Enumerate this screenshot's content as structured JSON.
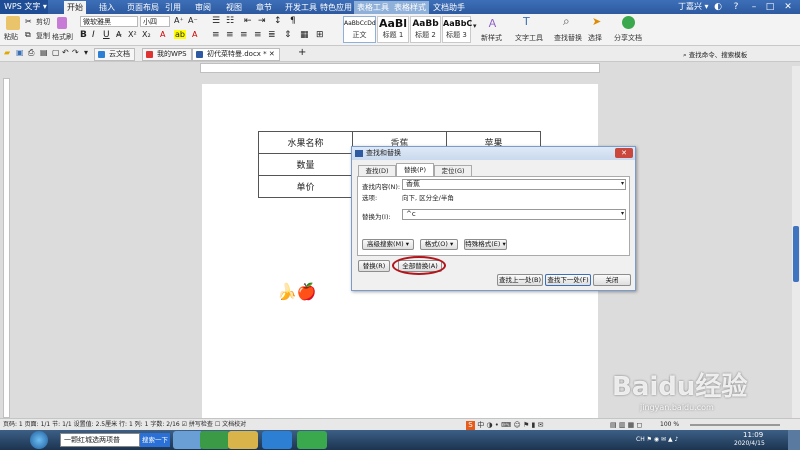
{
  "app": {
    "name": "WPS 文字",
    "user": "丁嘉兴"
  },
  "menu": {
    "tabs": [
      "开始",
      "插入",
      "页面布局",
      "引用",
      "审阅",
      "视图",
      "章节",
      "开发工具",
      "特色应用",
      "表格工具",
      "表格样式",
      "文档助手"
    ],
    "active": "开始"
  },
  "ribbon": {
    "paste": "粘贴",
    "cut": "剪切",
    "copy": "复制",
    "format_painter": "格式刷",
    "font": "微软雅黑",
    "font_size": "小四",
    "styles": [
      {
        "preview": "AaBbCcDd",
        "name": "正文"
      },
      {
        "preview": "AaBl",
        "name": "标题 1"
      },
      {
        "preview": "AaBb",
        "name": "标题 2"
      },
      {
        "preview": "AaBbC",
        "name": "标题 3"
      }
    ],
    "new_style": "新样式",
    "text_tools": "文字工具",
    "find_replace": "查找替换",
    "select": "选择",
    "share": "分享文档"
  },
  "qat": {
    "tabs": [
      "云文档",
      "我的WPS",
      "初代菜特曼.docx *"
    ],
    "search": "查找命令、搜索模板"
  },
  "document": {
    "table": [
      [
        "水果名称",
        "香蕉",
        "苹果"
      ],
      [
        "数量",
        "",
        ""
      ],
      [
        "单价",
        "",
        ""
      ]
    ],
    "emoji": "🍌🍎"
  },
  "dialog": {
    "title": "查找和替换",
    "tabs": [
      "查找(D)",
      "替换(P)",
      "定位(G)"
    ],
    "find_label": "查找内容(N):",
    "find_value": "香蕉",
    "options_label": "选项:",
    "options_value": "向下, 区分全/半角",
    "replace_label": "替换为(I):",
    "replace_value": "^c",
    "advanced": "高级搜索(M) ▾",
    "format": "格式(O) ▾",
    "special": "特殊格式(E) ▾",
    "replace_btn": "替换(R)",
    "replace_all_btn": "全部替换(A)",
    "find_prev": "查找上一处(B)",
    "find_next": "查找下一处(F)",
    "close": "关闭"
  },
  "status": {
    "text": "页码: 1   页面: 1/1   节: 1/1   设置值: 2.5厘米   行: 1   列: 1   字数: 2/16   ☑ 拼写检查   ☐ 文档校对",
    "zoom": "100 %"
  },
  "taskbar": {
    "address": "一颗红城选两项普",
    "search_btn": "搜索一下",
    "time": "11:09",
    "date": "2020/4/15",
    "ime": "中"
  },
  "watermark": "Baidu经验",
  "watermark_url": "jingyan.baidu.com",
  "colors": {
    "title_blue": "#2d5aa0",
    "ribbon_bg": "#f3f3f3",
    "highlight_red": "#b3141a",
    "dialog_border": "#7a9ccc"
  }
}
